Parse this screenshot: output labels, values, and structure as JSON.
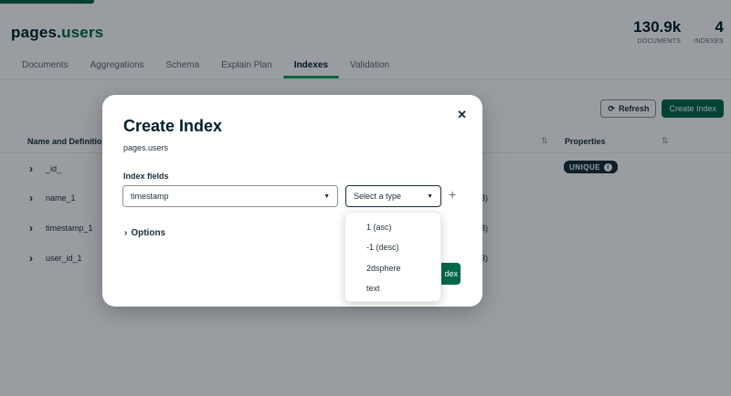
{
  "namespace": {
    "db": "pages.",
    "collection": "users"
  },
  "stats": [
    {
      "value": "130.9k",
      "label": "DOCUMENTS"
    },
    {
      "value": "4",
      "label": "INDEXES"
    }
  ],
  "tabs": [
    "Documents",
    "Aggregations",
    "Schema",
    "Explain Plan",
    "Indexes",
    "Validation"
  ],
  "active_tab": "Indexes",
  "toolbar": {
    "refresh_label": "Refresh",
    "create_label": "Create Index"
  },
  "table": {
    "headers": {
      "name": "Name and Definition",
      "properties": "Properties"
    },
    "rows": [
      {
        "name": "_id_",
        "frag": "",
        "badge": "UNIQUE"
      },
      {
        "name": "name_1",
        "frag": "3)"
      },
      {
        "name": "timestamp_1",
        "frag": "3)"
      },
      {
        "name": "user_id_1",
        "frag": "3)"
      }
    ]
  },
  "modal": {
    "title": "Create Index",
    "namespace": "pages.users",
    "fields_label": "Index fields",
    "field_value": "timestamp",
    "type_placeholder": "Select a type",
    "options_label": "Options",
    "submit_fragment": "dex",
    "close_icon": "close-icon"
  },
  "dropdown": {
    "options": [
      "1 (asc)",
      "-1 (desc)",
      "2dsphere",
      "text"
    ]
  },
  "colors": {
    "accent": "#00684a",
    "tab_underline": "#00a35c",
    "badge": "#1c2d38"
  }
}
